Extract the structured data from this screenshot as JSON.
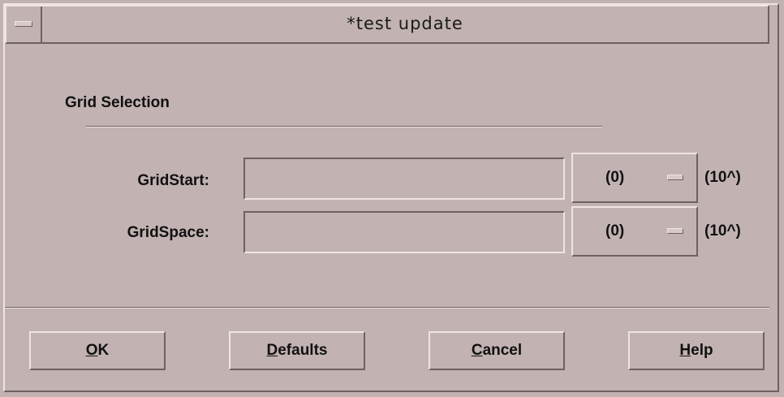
{
  "window": {
    "title": "*test update",
    "menu_icon": "window-menu-icon"
  },
  "section": {
    "label": "Grid Selection"
  },
  "rows": [
    {
      "label": "GridStart:",
      "value": "",
      "exponent": "(0)",
      "unit": "(10^)"
    },
    {
      "label": "GridSpace:",
      "value": "",
      "exponent": "(0)",
      "unit": "(10^)"
    }
  ],
  "buttons": [
    {
      "mnemonic": "O",
      "rest": "K"
    },
    {
      "mnemonic": "D",
      "rest": "efaults"
    },
    {
      "mnemonic": "C",
      "rest": "ancel"
    },
    {
      "mnemonic": "H",
      "rest": "elp"
    }
  ],
  "colors": {
    "background": "#c2b2b2",
    "highlight": "#efe4e4",
    "shadow": "#6f6161"
  }
}
